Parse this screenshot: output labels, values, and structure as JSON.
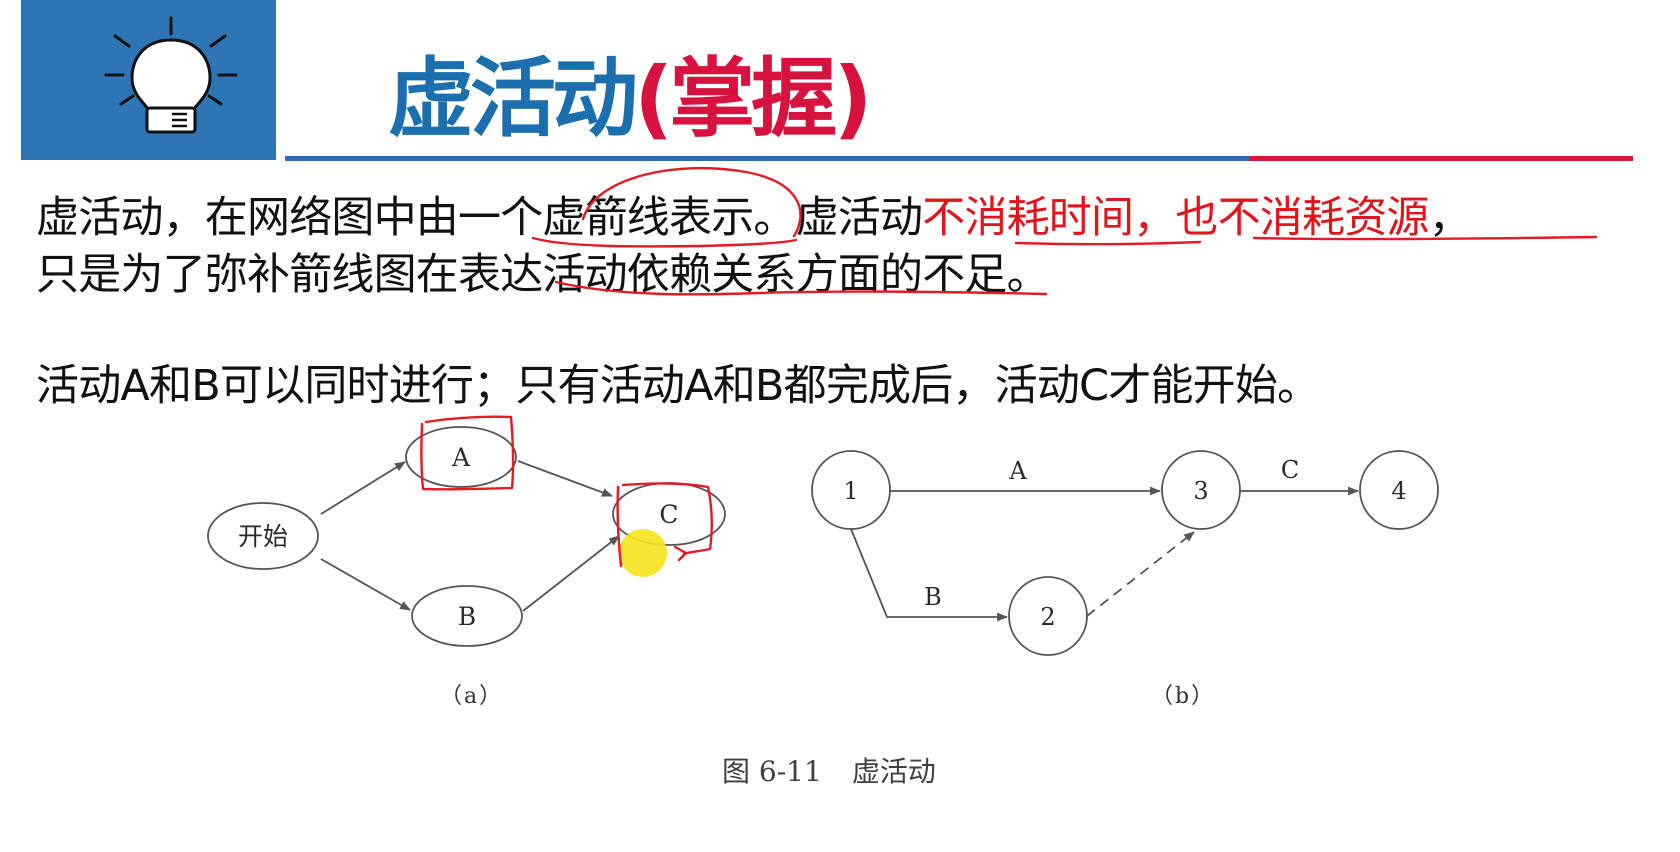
{
  "header": {
    "icon": "lightbulb-icon",
    "title_main": "虚活动",
    "title_tag": "(掌握)"
  },
  "content": {
    "p1_part1": "虚活动，在网络图中由一个虚箭线表示。虚活动",
    "p1_part2": "不消耗时间，也不消耗资源",
    "p1_part3": "，",
    "p2": "只是为了弥补箭线图在表达活动依赖关系方面的不足。",
    "p3": "活动A和B可以同时进行；只有活动A和B都完成后，活动C才能开始。"
  },
  "diagram_a": {
    "caption": "（a）",
    "start_label": "开始",
    "node_a_label": "A",
    "node_b_label": "B",
    "node_c_label": "C"
  },
  "diagram_b": {
    "caption": "（b）",
    "node_1_label": "1",
    "node_2_label": "2",
    "node_3_label": "3",
    "node_4_label": "4",
    "edge_a_label": "A",
    "edge_b_label": "B",
    "edge_c_label": "C"
  },
  "figure": {
    "number": "图 6-11",
    "title": "虚活动"
  },
  "colors": {
    "logo_blue": "#2e75b6",
    "title_blue": "#1b6fae",
    "title_red": "#d8123e",
    "emphasis_red": "#e0151c",
    "annotation_red": "#e41b23",
    "pointer_yellow": "#f4e31b"
  }
}
